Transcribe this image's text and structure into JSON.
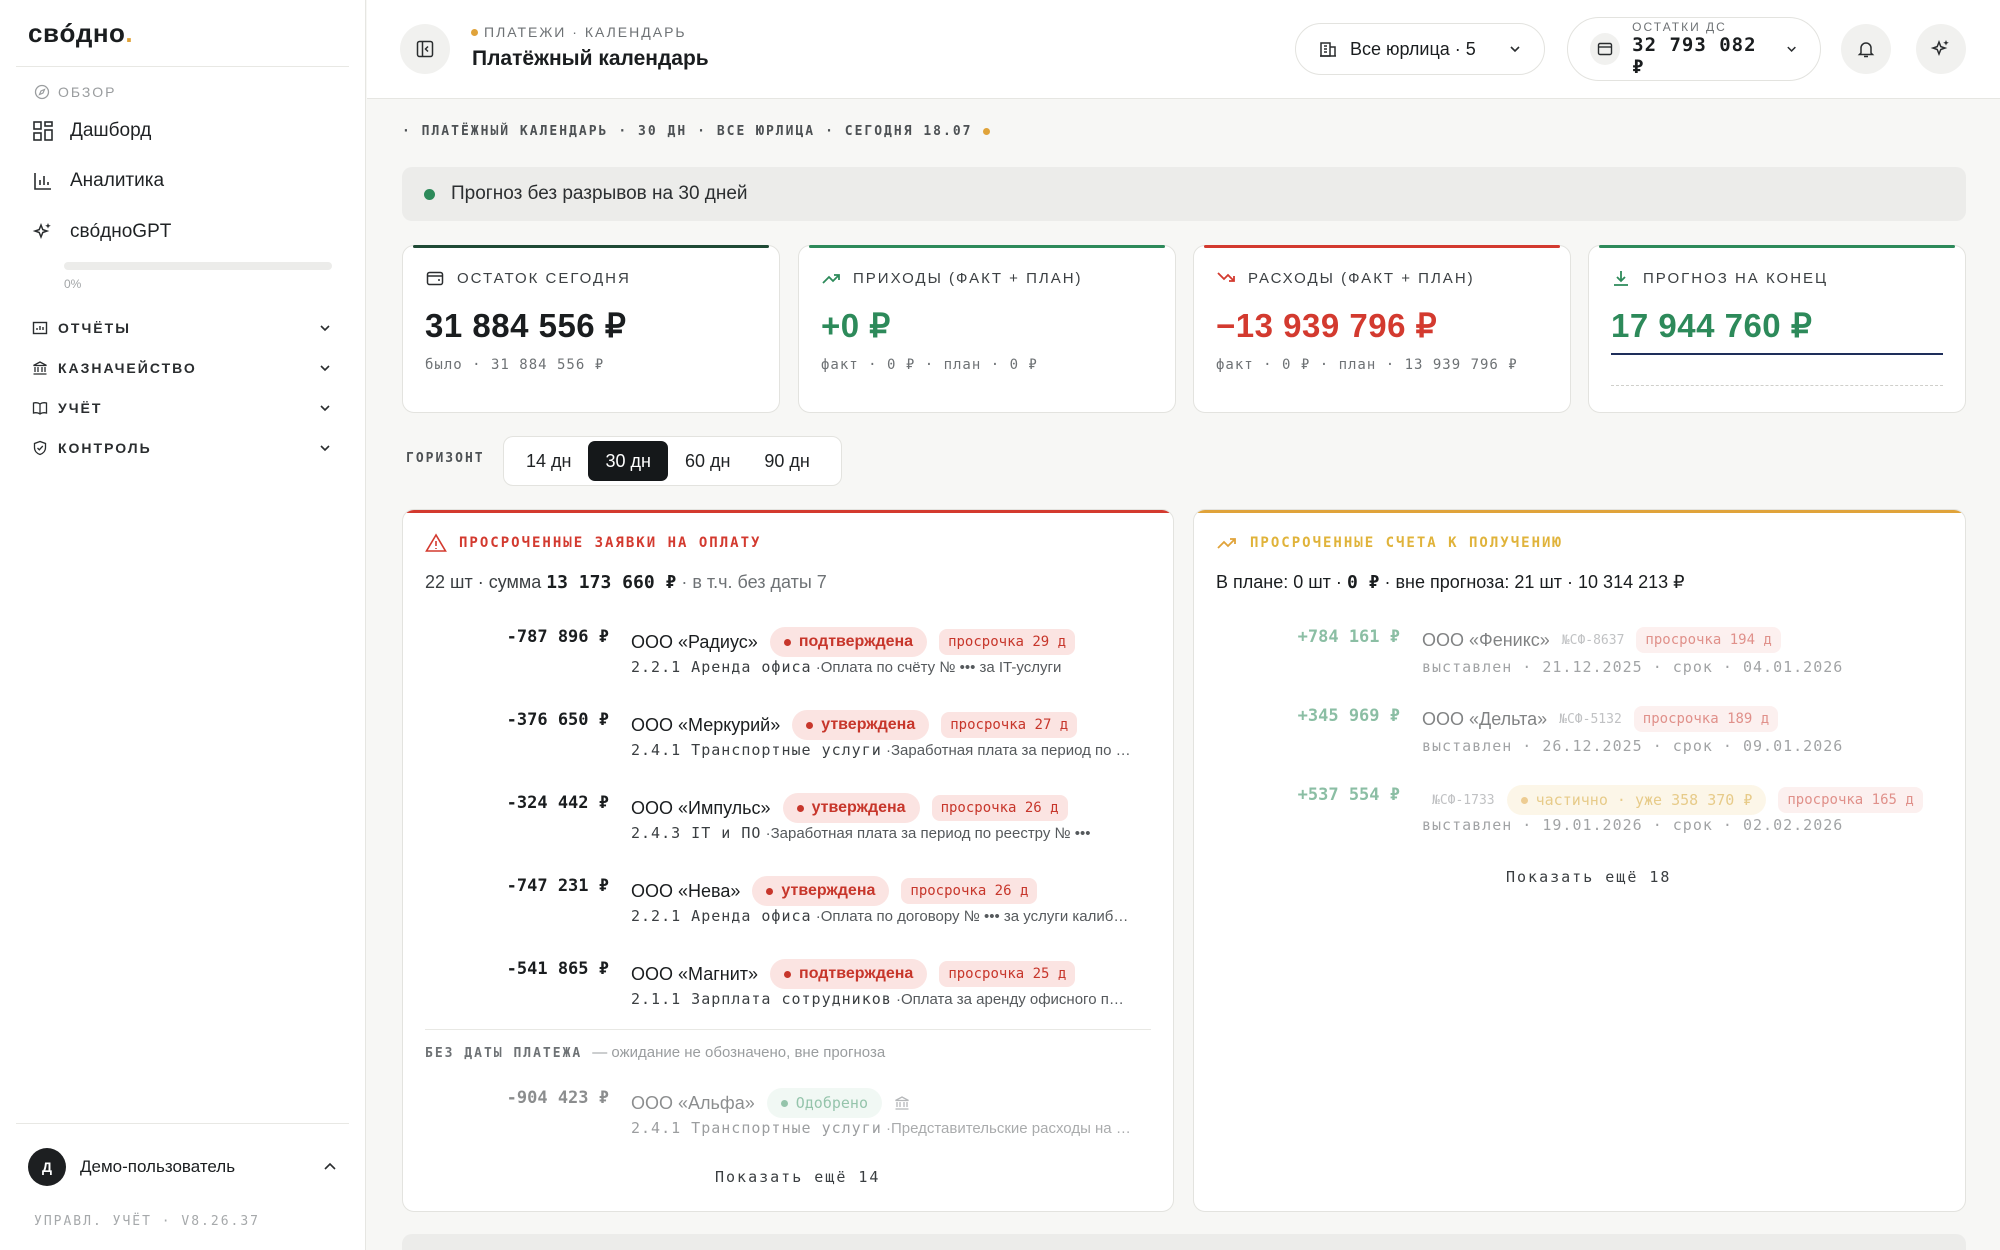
{
  "colors": {
    "accent_green": "#2d8a5a",
    "danger_red": "#d33a2f",
    "warning_yellow": "#e0a33a",
    "dark_navy": "#1e2e5a"
  },
  "sidebar": {
    "logo": "свóдно",
    "logo_dot": ".",
    "overview_label": "ОБЗОР",
    "nav": [
      {
        "label": "Дашборд",
        "icon": "grid-icon"
      },
      {
        "label": "Аналитика",
        "icon": "bar-chart-icon"
      },
      {
        "label": "свóдноGPT",
        "icon": "sparkle-icon"
      }
    ],
    "progress_percent": 0,
    "progress_label": "0%",
    "groups": [
      {
        "label": "ОТЧЁТЫ",
        "icon": "report-icon"
      },
      {
        "label": "КАЗНАЧЕЙСТВО",
        "icon": "bank-icon"
      },
      {
        "label": "УЧЁТ",
        "icon": "book-icon"
      },
      {
        "label": "КОНТРОЛЬ",
        "icon": "shield-icon"
      }
    ],
    "user": {
      "initial": "Д",
      "name": "Демо-пользователь"
    },
    "version": "УПРАВЛ. УЧЁТ · V8.26.37"
  },
  "topbar": {
    "breadcrumb": "ПЛАТЕЖИ · КАЛЕНДАРЬ",
    "title": "Платёжный календарь",
    "entity_select": "Все юрлица · 5",
    "balance_label": "ОСТАТКИ ДС",
    "balance_value": "32 793 082 ₽"
  },
  "main": {
    "context_line": [
      "· ПЛАТЁЖНЫЙ КАЛЕНДАРЬ",
      "· 30 ДН",
      "· ВСЕ ЮРЛИЦА",
      "· СЕГОДНЯ 18.07"
    ],
    "banner": "Прогноз без разрывов на 30 дней",
    "kpis": [
      {
        "label": "ОСТАТОК СЕГОДНЯ",
        "value": "31 884 556 ₽",
        "sub": "было · 31 884 556 ₽",
        "icon": "wallet-icon"
      },
      {
        "label": "ПРИХОДЫ (ФАКТ + ПЛАН)",
        "value": "+0 ₽",
        "sub": "факт · 0 ₽ · план · 0 ₽",
        "icon": "trend-up-icon"
      },
      {
        "label": "РАСХОДЫ (ФАКТ + ПЛАН)",
        "value": "−13 939 796 ₽",
        "sub": "факт · 0 ₽ · план · 13 939 796 ₽",
        "icon": "trend-down-icon"
      },
      {
        "label": "ПРОГНОЗ НА КОНЕЦ",
        "value": "17 944 760 ₽",
        "sub": "",
        "icon": "download-icon"
      }
    ],
    "horizon_label": "ГОРИЗОНТ",
    "horizon_options": [
      "14 дн",
      "30 дн",
      "60 дн",
      "90 дн"
    ],
    "horizon_selected": "30 дн",
    "overdue_payments": {
      "title": "ПРОСРОЧЕННЫЕ ЗАЯВКИ НА ОПЛАТУ",
      "summary_prefix": "22 шт · сумма",
      "summary_amount": "13 173 660 ₽",
      "summary_suffix": "· в т.ч. без даты 7",
      "rows": [
        {
          "amount": "-787 896 ₽",
          "company": "ООО «Радиус»",
          "status": "подтверждена",
          "overdue": "просрочка 29 д",
          "code": "2.2.1 Аренда офиса",
          "desc": "·Оплата по счёту № ••• за IT-услуги"
        },
        {
          "amount": "-376 650 ₽",
          "company": "ООО «Меркурий»",
          "status": "утверждена",
          "overdue": "просрочка 27 д",
          "code": "2.4.1 Транспортные услуги",
          "desc": "·Заработная плата за период по реестру № •••"
        },
        {
          "amount": "-324 442 ₽",
          "company": "ООО «Импульс»",
          "status": "утверждена",
          "overdue": "просрочка 26 д",
          "code": "2.4.3 IT и ПО",
          "desc": "·Заработная плата за период по реестру № •••"
        },
        {
          "amount": "-747 231 ₽",
          "company": "ООО «Нева»",
          "status": "утверждена",
          "overdue": "просрочка 26 д",
          "code": "2.2.1 Аренда офиса",
          "desc": "·Оплата по договору № ••• за услуги калибровки"
        },
        {
          "amount": "-541 865 ₽",
          "company": "ООО «Магнит»",
          "status": "подтверждена",
          "overdue": "просрочка 25 д",
          "code": "2.1.1 Зарплата сотрудников",
          "desc": "·Оплата за аренду офисного помещения"
        }
      ],
      "nodate_label": "БЕЗ ДАТЫ ПЛАТЕЖА",
      "nodate_note": "— ожидание не обозначено, вне прогноза",
      "nodate_row": {
        "amount": "-904 423 ₽",
        "company": "ООО «Альфа»",
        "status": "Одобрено",
        "code": "2.4.1 Транспортные услуги",
        "desc": "·Представительские расходы на встречу"
      },
      "show_more": "Показать ещё 14"
    },
    "overdue_receivables": {
      "title": "ПРОСРОЧЕННЫЕ СЧЕТА К ПОЛУЧЕНИЮ",
      "summary_prefix": "В плане: 0 шт ·",
      "summary_amount": "0 ₽",
      "summary_suffix": "· вне прогноза: 21 шт · 10 314 213 ₽",
      "rows": [
        {
          "amount": "+784 161 ₽",
          "company": "ООО «Феникс»",
          "invoice": "№СФ-8637",
          "overdue": "просрочка 194 д",
          "dates": "выставлен · 21.12.2025 · срок · 04.01.2026"
        },
        {
          "amount": "+345 969 ₽",
          "company": "ООО «Дельта»",
          "invoice": "№СФ-5132",
          "overdue": "просрочка 189 д",
          "dates": "выставлен · 26.12.2025 · срок · 09.01.2026"
        },
        {
          "amount": "+537 554 ₽",
          "company": "",
          "invoice": "№СФ-1733",
          "partial": "частично · уже 358 370 ₽",
          "overdue": "просрочка 165 д",
          "dates": "выставлен · 19.01.2026 · срок · 02.02.2026"
        }
      ],
      "show_more": "Показать ещё 18"
    }
  }
}
